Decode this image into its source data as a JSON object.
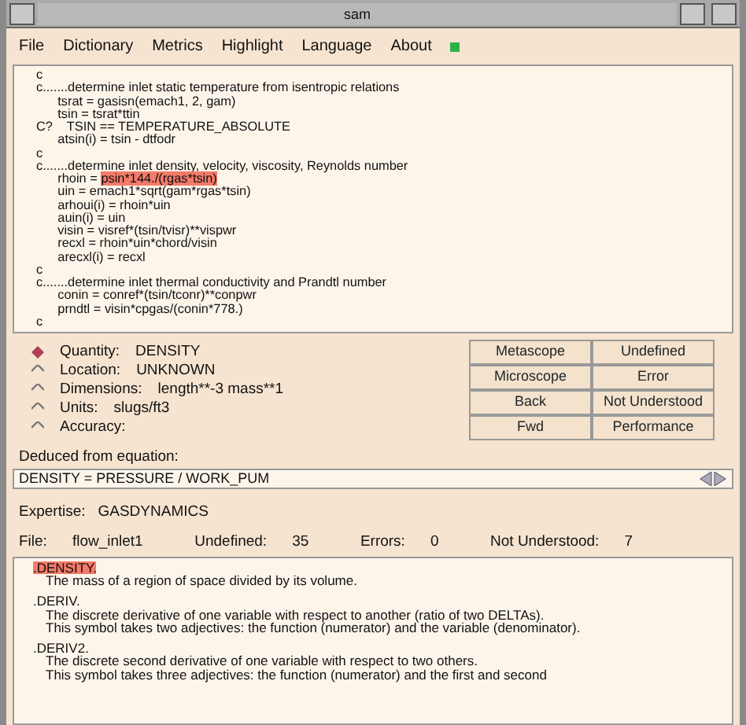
{
  "window": {
    "title": "sam"
  },
  "menu": [
    {
      "label": "File"
    },
    {
      "label": "Dictionary"
    },
    {
      "label": "Metrics"
    },
    {
      "label": "Highlight"
    },
    {
      "label": "Language"
    },
    {
      "label": "About"
    }
  ],
  "code": [
    {
      "text": "c"
    },
    {
      "text": "c.......determine inlet static temperature from isentropic relations"
    },
    {
      "text": "      tsrat = gasisn(emach1, 2, gam)"
    },
    {
      "text": "      tsin = tsrat*ttin"
    },
    {
      "text": "C?    TSIN == TEMPERATURE_ABSOLUTE"
    },
    {
      "text": "      atsin(i) = tsin - dtfodr"
    },
    {
      "text": "c"
    },
    {
      "text": "c.......determine inlet density, velocity, viscosity, Reynolds number"
    },
    {
      "text": "      rhoin = ",
      "highlight": "psin*144./(rgas*tsin)"
    },
    {
      "text": "      uin = emach1*sqrt(gam*rgas*tsin)"
    },
    {
      "text": "      arhoui(i) = rhoin*uin"
    },
    {
      "text": "      auin(i) = uin"
    },
    {
      "text": "      visin = visref*(tsin/tvisr)**vispwr"
    },
    {
      "text": "      recxl = rhoin*uin*chord/visin"
    },
    {
      "text": "      arecxl(i) = recxl"
    },
    {
      "text": "c"
    },
    {
      "text": "c.......determine inlet thermal conductivity and Prandtl number"
    },
    {
      "text": "      conin = conref*(tsin/tconr)**conpwr"
    },
    {
      "text": "      prndtl = visin*cpgas/(conin*778.)"
    },
    {
      "text": "c"
    }
  ],
  "properties": [
    {
      "label": "Quantity:",
      "value": "DENSITY",
      "selected": true
    },
    {
      "label": "Location:",
      "value": "UNKNOWN",
      "selected": false
    },
    {
      "label": "Dimensions:",
      "value": "length**-3 mass**1",
      "selected": false
    },
    {
      "label": "Units:",
      "value": "slugs/ft3",
      "selected": false
    },
    {
      "label": "Accuracy:",
      "selected": false
    }
  ],
  "buttons": [
    [
      "Metascope",
      "Undefined"
    ],
    [
      "Microscope",
      "Error"
    ],
    [
      "Back",
      "Not Understood"
    ],
    [
      "Fwd",
      "Performance"
    ]
  ],
  "deduced_label": "Deduced from equation:",
  "equation": "DENSITY = PRESSURE / WORK_PUM",
  "expertise": {
    "label": "Expertise:",
    "value": "GASDYNAMICS"
  },
  "stats": [
    {
      "label": "File:",
      "value": "flow_inlet1"
    },
    {
      "label": "Undefined:",
      "value": "35"
    },
    {
      "label": "Errors:",
      "value": "0"
    },
    {
      "label": "Not Understood:",
      "value": "7"
    }
  ],
  "definitions": [
    {
      "kind": "term",
      "text": ".DENSITY.",
      "selected": true
    },
    {
      "kind": "text",
      "text": "The mass of a region of space divided by its volume."
    },
    {
      "kind": "term",
      "text": ".DERIV.",
      "selected": false
    },
    {
      "kind": "text",
      "text": "The discrete derivative of one variable with respect to another (ratio of two DELTAs)."
    },
    {
      "kind": "text",
      "text": "This symbol takes two adjectives: the function (numerator) and the variable (denominator)."
    },
    {
      "kind": "term",
      "text": ".DERIV2.",
      "selected": false
    },
    {
      "kind": "text",
      "text": "The discrete second derivative of one variable with respect to two others."
    },
    {
      "kind": "text",
      "text": "This symbol takes three adjectives: the function (numerator) and the first and second"
    }
  ]
}
